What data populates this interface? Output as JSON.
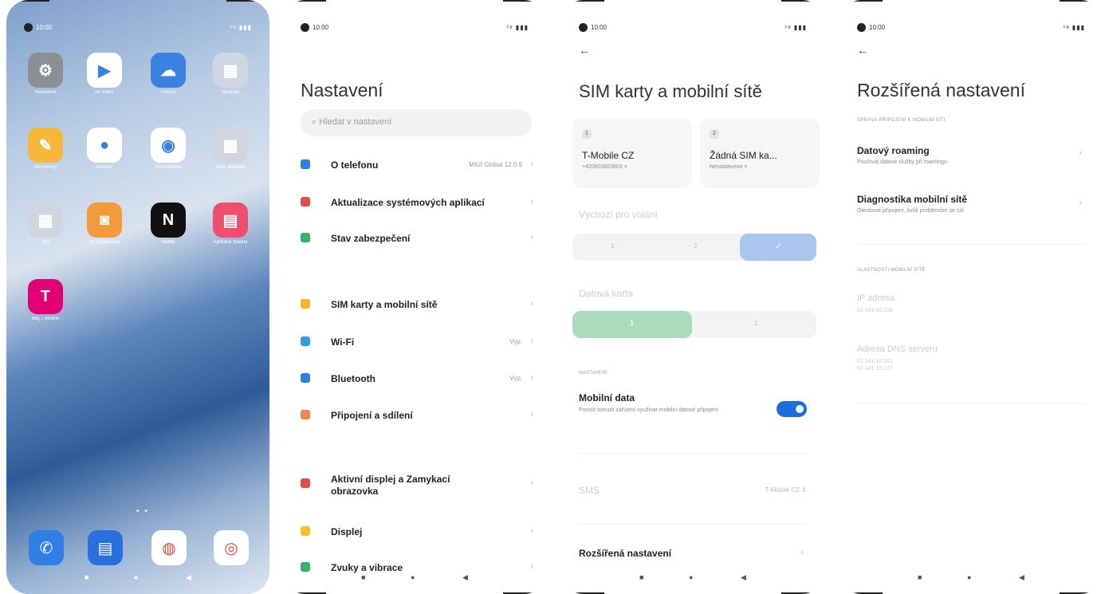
{
  "status": {
    "time": "10:00",
    "signal": "⁵ᵍ ▮▮▮"
  },
  "home": {
    "apps": [
      {
        "label": "Nastavení",
        "icon": "settings-icon",
        "color": "#8a9096",
        "glyph": "⚙"
      },
      {
        "label": "Hr Video",
        "icon": "play-icon",
        "color": "#ffffff",
        "glyph": "▶"
      },
      {
        "label": "Počasí",
        "icon": "weather-icon",
        "color": "#3b82e0",
        "glyph": "☁"
      },
      {
        "label": "Nástroje",
        "icon": "tools-folder-icon",
        "color": "#cfd6e2",
        "glyph": "▦"
      },
      {
        "label": "Poznámky",
        "icon": "notes-icon",
        "color": "#f5b83a",
        "glyph": "✎"
      },
      {
        "label": "Asistent",
        "icon": "assistant-icon",
        "color": "#ffffff",
        "glyph": "●"
      },
      {
        "label": "Mi Prohlížeč",
        "icon": "browser-icon",
        "color": "#ffffff",
        "glyph": "◉"
      },
      {
        "label": "Další aplikace",
        "icon": "apps-folder-icon",
        "color": "#cfd6e2",
        "glyph": "▦"
      },
      {
        "label": "Hry",
        "icon": "games-folder-icon",
        "color": "#cfd6e2",
        "glyph": "▦"
      },
      {
        "label": "Mi Community",
        "icon": "community-icon",
        "color": "#f39a3a",
        "glyph": "◙"
      },
      {
        "label": "Netflix",
        "icon": "netflix-icon",
        "color": "#111111",
        "glyph": "N"
      },
      {
        "label": "Aplikace Xiaomi",
        "icon": "store-icon",
        "color": "#ef4f6e",
        "glyph": "▤"
      },
      {
        "label": "Můj T-Mobile",
        "icon": "tmobile-icon",
        "color": "#e20074",
        "glyph": "T"
      }
    ],
    "dock": [
      {
        "icon": "phone-icon",
        "color": "#2f7fe5",
        "glyph": "✆"
      },
      {
        "icon": "messages-icon",
        "color": "#2a6fe0",
        "glyph": "▤"
      },
      {
        "icon": "chrome-icon",
        "color": "#ffffff",
        "glyph": "◍"
      },
      {
        "icon": "camera-icon",
        "color": "#ffffff",
        "glyph": "◎"
      }
    ]
  },
  "settings": {
    "title": "Nastavení",
    "search_placeholder": "Hledat v nastavení",
    "items": [
      {
        "label": "O telefonu",
        "value": "MIUI Global 12.0.9",
        "icon": "info-icon",
        "color": "#2f7fe5"
      },
      {
        "label": "Aktualizace systémových aplikací",
        "value": "",
        "icon": "update-icon",
        "color": "#e54b4b"
      },
      {
        "label": "Stav zabezpečení",
        "value": "",
        "icon": "shield-icon",
        "color": "#37b26c"
      },
      {
        "label": "SIM karty a mobilní sítě",
        "value": "",
        "icon": "sim-icon",
        "color": "#f3b52d"
      },
      {
        "label": "Wi-Fi",
        "value": "Vyp.",
        "icon": "wifi-icon",
        "color": "#2f9ee5"
      },
      {
        "label": "Bluetooth",
        "value": "Vyp.",
        "icon": "bluetooth-icon",
        "color": "#2f7fe5"
      },
      {
        "label": "Připojení a sdílení",
        "value": "",
        "icon": "share-icon",
        "color": "#f08a4b"
      },
      {
        "label": "Aktivní displej a Zamykací obrazovka",
        "value": "",
        "icon": "lock-icon",
        "color": "#e54b4b"
      },
      {
        "label": "Displej",
        "value": "",
        "icon": "sun-icon",
        "color": "#f3c12d"
      },
      {
        "label": "Zvuky a vibrace",
        "value": "",
        "icon": "sound-icon",
        "color": "#37b26c"
      }
    ]
  },
  "sim": {
    "title": "SIM karty a mobilní sítě",
    "sim1": {
      "num": "1",
      "name": "T-Mobile CZ",
      "sub": "+420603603603 >"
    },
    "sim2": {
      "num": "2",
      "name": "Žádná SIM ka...",
      "sub": "Nenastaveno >"
    },
    "default_calls": "Výchozí pro volání",
    "calls_opts": [
      "1",
      "2",
      "✓"
    ],
    "data_card": "Datová karta",
    "data_opts": [
      "1",
      "2"
    ],
    "section": "NASTAVENÍ",
    "mobile_data": "Mobilní data",
    "mobile_data_sub": "Povolit tomuto zařízení využívat mobilní datové připojení",
    "sms": "SMS",
    "sms_value": "T-Mobile CZ ⇕",
    "advanced": "Rozšířená nastavení"
  },
  "advanced": {
    "title": "Rozšířená nastavení",
    "section1": "SPRÁVA PŘIPOJENÍ K MOBILNÍ SÍTI",
    "roaming": "Datový roaming",
    "roaming_sub": "Používat datové služby při roamingu",
    "diag": "Diagnostika mobilní sítě",
    "diag_sub": "Otestovat připojení, kvůli problémům se sítí",
    "section2": "VLASTNOSTI MOBILNÍ SÍTĚ",
    "ip_label": "IP adresa",
    "ip_value": "62.141.30.208",
    "dns_label": "Adresa DNS serveru",
    "dns_value1": "62.141.16.161",
    "dns_value2": "62.141.16.177"
  }
}
